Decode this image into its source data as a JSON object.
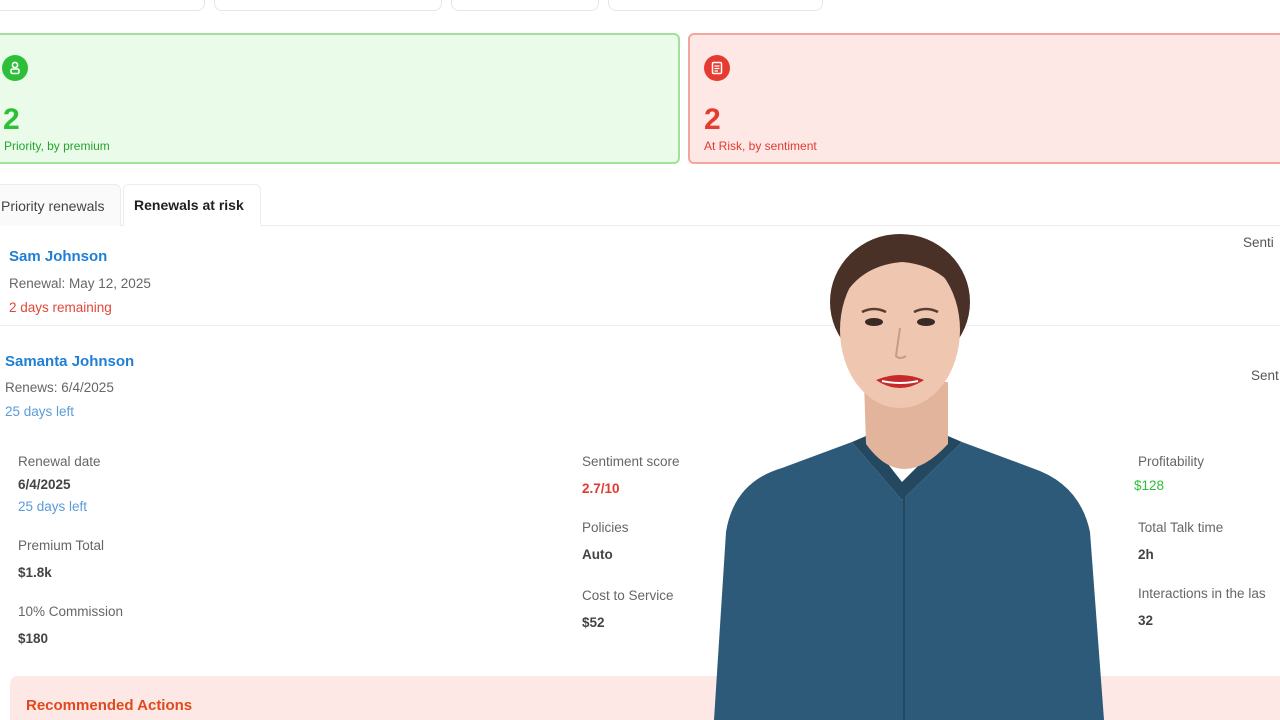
{
  "summary_cards": [
    {
      "icon": "person-icon",
      "count": "2",
      "label": "Priority, by premium",
      "color": "#2ebf39"
    },
    {
      "icon": "document-icon",
      "count": "2",
      "label": "At Risk, by sentiment",
      "color": "#e53b30"
    }
  ],
  "tabs": [
    {
      "label": "Priority renewals",
      "active": false
    },
    {
      "label": "Renewals at risk",
      "active": true
    }
  ],
  "renewals": [
    {
      "name": "Sam Johnson",
      "renewal": "Renewal: May 12, 2025",
      "remaining": "2 days remaining",
      "right_label": "Senti"
    },
    {
      "name": "Samanta Johnson",
      "renewal": "Renews: 6/4/2025",
      "remaining": "25 days left",
      "right_label": "Sent"
    }
  ],
  "details": {
    "renewal_date": {
      "label": "Renewal date",
      "value": "6/4/2025",
      "sub": "25 days left"
    },
    "premium_total": {
      "label": "Premium Total",
      "value": "$1.8k"
    },
    "commission": {
      "label": "10% Commission",
      "value": "$180"
    },
    "sentiment_score": {
      "label": "Sentiment score",
      "value": "2.7/10"
    },
    "policies": {
      "label": "Policies",
      "value": "Auto"
    },
    "cost_to_service": {
      "label": "Cost to Service",
      "value": "$52"
    },
    "profitability": {
      "label": "Profitability",
      "value": "$128"
    },
    "total_talk_time": {
      "label": "Total Talk time",
      "value": "2h"
    },
    "interactions": {
      "label": "Interactions in the las",
      "value": "32"
    }
  },
  "recommended_actions": {
    "title": "Recommended Actions"
  }
}
